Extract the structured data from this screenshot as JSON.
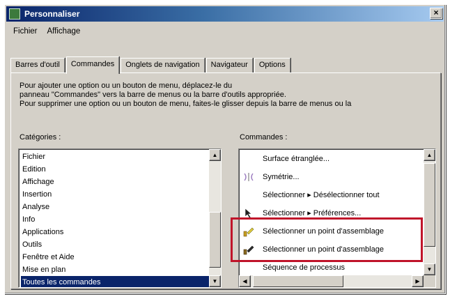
{
  "window": {
    "title": "Personnaliser",
    "close_glyph": "×"
  },
  "menubar": {
    "items": [
      "Fichier",
      "Affichage"
    ]
  },
  "tabs": [
    {
      "label": "Barres d'outil",
      "active": false
    },
    {
      "label": "Commandes",
      "active": true
    },
    {
      "label": "Onglets de navigation",
      "active": false
    },
    {
      "label": "Navigateur",
      "active": false
    },
    {
      "label": "Options",
      "active": false
    }
  ],
  "description": {
    "line1": "Pour ajouter une option ou un bouton de menu, déplacez-le du",
    "line2": "panneau \"Commandes\" vers la barre de menus ou la barre d'outils appropriée.",
    "line3": "Pour supprimer une option ou un bouton de menu, faites-le glisser depuis la barre de menus ou la"
  },
  "categories": {
    "label": "Catégories :",
    "items": [
      "Fichier",
      "Edition",
      "Affichage",
      "Insertion",
      "Analyse",
      "Info",
      "Applications",
      "Outils",
      "Fenêtre et Aide",
      "Mise en plan",
      "Toutes les commandes"
    ],
    "selected": "Toutes les commandes"
  },
  "commands": {
    "label": "Commandes :",
    "items": [
      {
        "label": "Surface étranglée...",
        "icon": "none"
      },
      {
        "label": "Symétrie...",
        "icon": "symmetry-icon"
      },
      {
        "label": "Sélectionner ▸ Désélectionner tout",
        "icon": "none"
      },
      {
        "label": "Sélectionner ▸ Préférences...",
        "icon": "cursor-icon"
      },
      {
        "label": "Sélectionner un point d'assemblage",
        "icon": "assembly-point-icon-yellow"
      },
      {
        "label": "Sélectionner un point d'assemblage",
        "icon": "assembly-point-icon-dark"
      },
      {
        "label": "Séquence de processus",
        "icon": "none"
      }
    ]
  },
  "colors": {
    "dialog_bg": "#d4d0c8",
    "titlebar_start": "#0a246a",
    "selection": "#0a246a",
    "highlight_box": "#c0142a"
  }
}
